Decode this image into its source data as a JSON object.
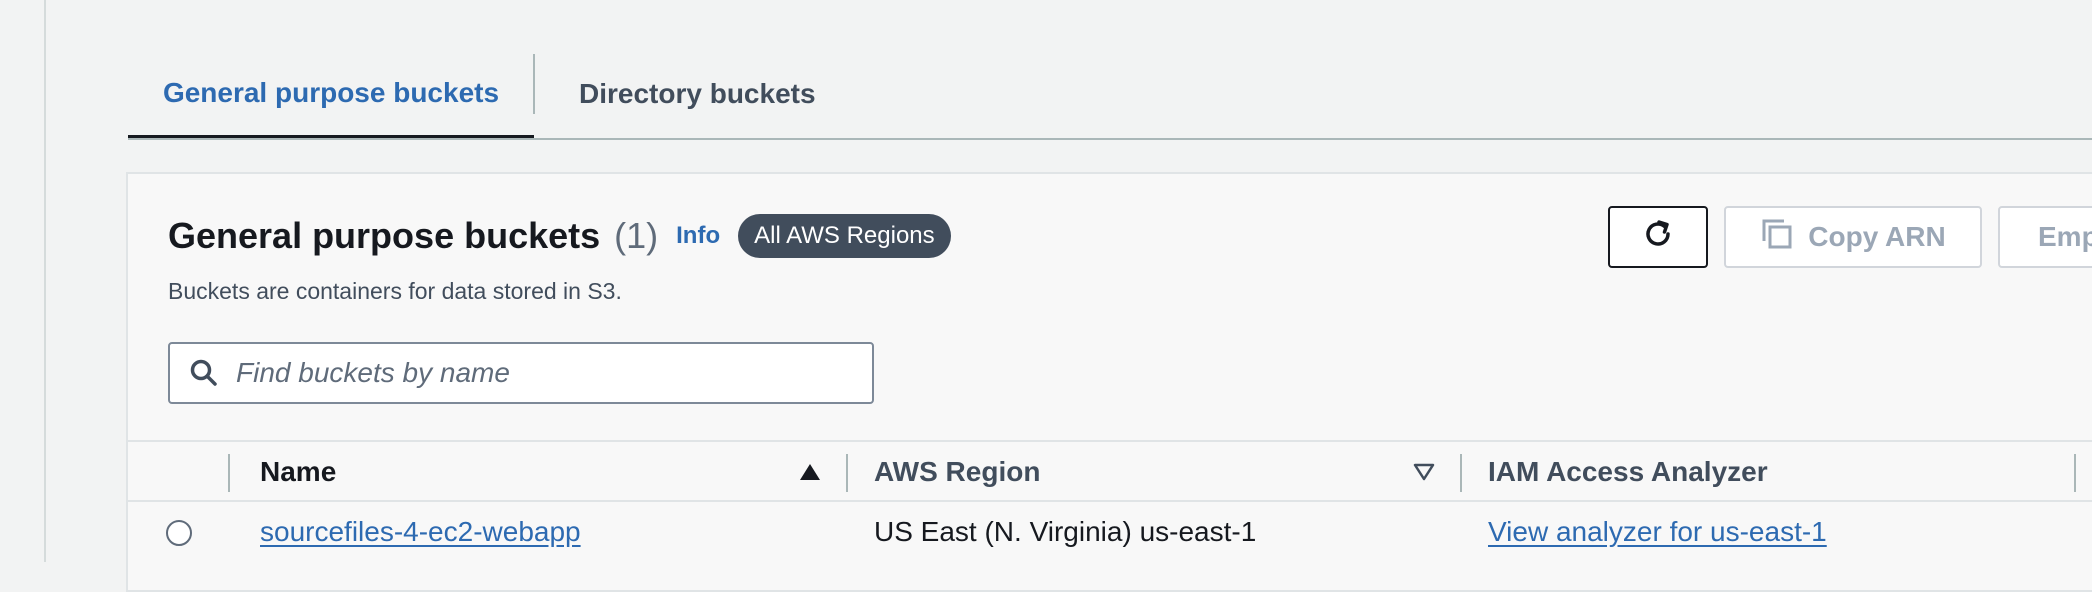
{
  "tabs": {
    "general": "General purpose buckets",
    "directory": "Directory buckets"
  },
  "panel": {
    "title": "General purpose buckets",
    "count": "(1)",
    "info": "Info",
    "region_badge": "All AWS Regions",
    "description": "Buckets are containers for data stored in S3.",
    "search_placeholder": "Find buckets by name"
  },
  "actions": {
    "refresh_icon": "refresh-icon",
    "copy_arn": "Copy ARN",
    "copy_icon": "copy-icon",
    "empty": "Emp"
  },
  "table": {
    "columns": {
      "name": "Name",
      "region": "AWS Region",
      "analyzer": "IAM Access Analyzer"
    },
    "rows": [
      {
        "name": "sourcefiles-4-ec2-webapp",
        "region": "US East (N. Virginia) us-east-1",
        "analyzer": "View analyzer for us-east-1"
      }
    ]
  },
  "colors": {
    "accent_link": "#2d6ab1",
    "badge_bg": "#414d5c",
    "page_bg": "#f2f3f3"
  }
}
